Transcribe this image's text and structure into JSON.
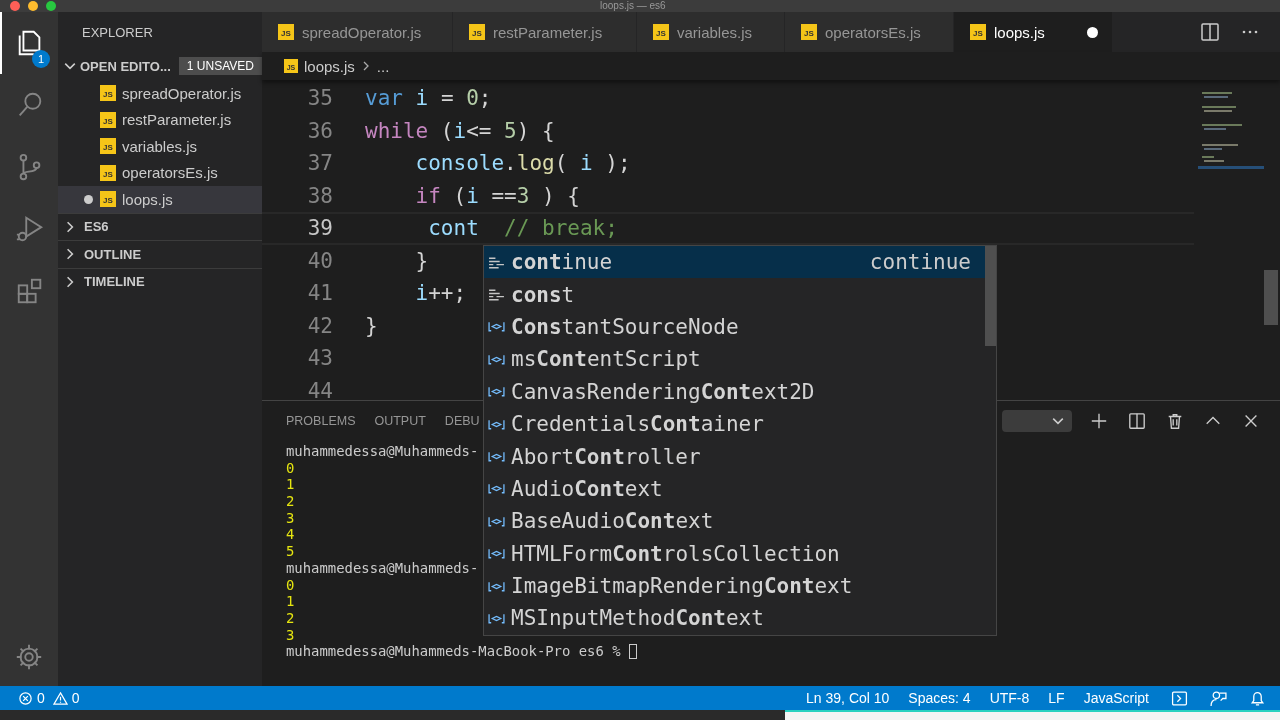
{
  "window": {
    "title": "loops.js — es6"
  },
  "activity_bar": [
    {
      "kind": "files",
      "selected": true,
      "badge": "1"
    },
    {
      "kind": "search",
      "selected": false
    },
    {
      "kind": "source-control",
      "selected": false
    },
    {
      "kind": "run-debug",
      "selected": false
    },
    {
      "kind": "extensions",
      "selected": false
    }
  ],
  "sidebar": {
    "title": "EXPLORER",
    "open_editors": {
      "label": "OPEN EDITO...",
      "expanded": true,
      "badge": "1 UNSAVED",
      "files": [
        {
          "name": "spreadOperator.js",
          "icon": "JS",
          "modified": false,
          "selected": false
        },
        {
          "name": "restParameter.js",
          "icon": "JS",
          "modified": false,
          "selected": false
        },
        {
          "name": "variables.js",
          "icon": "JS",
          "modified": false,
          "selected": false
        },
        {
          "name": "operatorsEs.js",
          "icon": "JS",
          "modified": false,
          "selected": false
        },
        {
          "name": "loops.js",
          "icon": "JS",
          "modified": true,
          "selected": true
        }
      ]
    },
    "sections": [
      {
        "label": "ES6",
        "expanded": false
      },
      {
        "label": "OUTLINE",
        "expanded": false
      },
      {
        "label": "TIMELINE",
        "expanded": false
      }
    ]
  },
  "tabs": [
    {
      "label": "spreadOperator.js",
      "icon": "JS",
      "selected": false,
      "modified": false
    },
    {
      "label": "restParameter.js",
      "icon": "JS",
      "selected": false,
      "modified": false
    },
    {
      "label": "variables.js",
      "icon": "JS",
      "selected": false,
      "modified": false
    },
    {
      "label": "operatorsEs.js",
      "icon": "JS",
      "selected": false,
      "modified": false
    },
    {
      "label": "loops.js",
      "icon": "JS",
      "selected": true,
      "modified": true
    }
  ],
  "breadcrumb": {
    "icon": "JS",
    "file": "loops.js",
    "rest": "..."
  },
  "code_lines": [
    {
      "number": "35",
      "current": false,
      "tokens": [
        {
          "text": "var",
          "kind": "kw"
        },
        {
          "text": " i",
          "kind": "var"
        },
        {
          "text": " = ",
          "kind": "plain"
        },
        {
          "text": "0",
          "kind": "num"
        },
        {
          "text": ";",
          "kind": "plain"
        }
      ]
    },
    {
      "number": "36",
      "current": false,
      "tokens": [
        {
          "text": "while",
          "kind": "ctrl"
        },
        {
          "text": " (",
          "kind": "plain"
        },
        {
          "text": "i",
          "kind": "var"
        },
        {
          "text": "<= ",
          "kind": "plain"
        },
        {
          "text": "5",
          "kind": "num"
        },
        {
          "text": ") {",
          "kind": "plain"
        }
      ]
    },
    {
      "number": "37",
      "current": false,
      "tokens": [
        {
          "text": "    console",
          "kind": "var"
        },
        {
          "text": ".",
          "kind": "plain"
        },
        {
          "text": "log",
          "kind": "fn"
        },
        {
          "text": "( ",
          "kind": "plain"
        },
        {
          "text": "i",
          "kind": "var"
        },
        {
          "text": " );",
          "kind": "plain"
        }
      ]
    },
    {
      "number": "38",
      "current": false,
      "tokens": [
        {
          "text": "    if",
          "kind": "ctrl"
        },
        {
          "text": " (",
          "kind": "plain"
        },
        {
          "text": "i",
          "kind": "var"
        },
        {
          "text": " ==",
          "kind": "plain"
        },
        {
          "text": "3",
          "kind": "num"
        },
        {
          "text": " ) {",
          "kind": "plain"
        }
      ]
    },
    {
      "number": "39",
      "current": true,
      "tokens": [
        {
          "text": "     cont",
          "kind": "var"
        },
        {
          "text": "  // break;",
          "kind": "comment"
        }
      ]
    },
    {
      "number": "40",
      "current": false,
      "tokens": [
        {
          "text": "    }",
          "kind": "plain"
        }
      ]
    },
    {
      "number": "41",
      "current": false,
      "tokens": [
        {
          "text": "    i",
          "kind": "var"
        },
        {
          "text": "++;",
          "kind": "plain"
        }
      ]
    },
    {
      "number": "42",
      "current": false,
      "tokens": [
        {
          "text": "}",
          "kind": "plain"
        }
      ]
    },
    {
      "number": "43",
      "current": false
    },
    {
      "number": "44",
      "current": false
    }
  ],
  "suggestions": [
    {
      "label": "**cont**inue",
      "kind": "keyword",
      "selected": true,
      "detail": "continue"
    },
    {
      "label": "**cons**t",
      "kind": "keyword",
      "selected": false
    },
    {
      "label": "**Cons**tantSourceNode",
      "kind": "variable",
      "selected": false
    },
    {
      "label": "ms**Cont**entScript",
      "kind": "variable",
      "selected": false
    },
    {
      "label": "CanvasRendering**Cont**ext2D",
      "kind": "variable",
      "selected": false
    },
    {
      "label": "Credentials**Cont**ainer",
      "kind": "variable",
      "selected": false
    },
    {
      "label": "Abort**Cont**roller",
      "kind": "variable",
      "selected": false
    },
    {
      "label": "Audio**Cont**ext",
      "kind": "variable",
      "selected": false
    },
    {
      "label": "BaseAudio**Cont**ext",
      "kind": "variable",
      "selected": false
    },
    {
      "label": "HTMLForm**Cont**rolsCollection",
      "kind": "variable",
      "selected": false
    },
    {
      "label": "ImageBitmapRendering**Cont**ext",
      "kind": "variable",
      "selected": false
    },
    {
      "label": "MSInputMethod**Cont**ext",
      "kind": "variable",
      "selected": false
    }
  ],
  "panel": {
    "tabs": [
      {
        "label": "PROBLEMS",
        "selected": false
      },
      {
        "label": "OUTPUT",
        "selected": false
      },
      {
        "label": "DEBU",
        "selected": false
      }
    ],
    "terminal": [
      {
        "text": "muhammedessa@Muhammeds-",
        "kind": "prompt"
      },
      {
        "text": "0",
        "kind": "output"
      },
      {
        "text": "1",
        "kind": "output"
      },
      {
        "text": "2",
        "kind": "output"
      },
      {
        "text": "3",
        "kind": "output"
      },
      {
        "text": "4",
        "kind": "output"
      },
      {
        "text": "5",
        "kind": "output"
      },
      {
        "text": "muhammedessa@Muhammeds-",
        "kind": "prompt"
      },
      {
        "text": "0",
        "kind": "output"
      },
      {
        "text": "1",
        "kind": "output"
      },
      {
        "text": "2",
        "kind": "output"
      },
      {
        "text": "3",
        "kind": "output"
      },
      {
        "text": "muhammedessa@Muhammeds-MacBook-Pro es6 % ",
        "kind": "prompt",
        "cursor": true
      }
    ]
  },
  "status_bar": {
    "errors": "0",
    "warnings": "0",
    "items": [
      "Ln 39, Col 10",
      "Spaces: 4",
      "UTF-8",
      "LF",
      "JavaScript"
    ]
  }
}
